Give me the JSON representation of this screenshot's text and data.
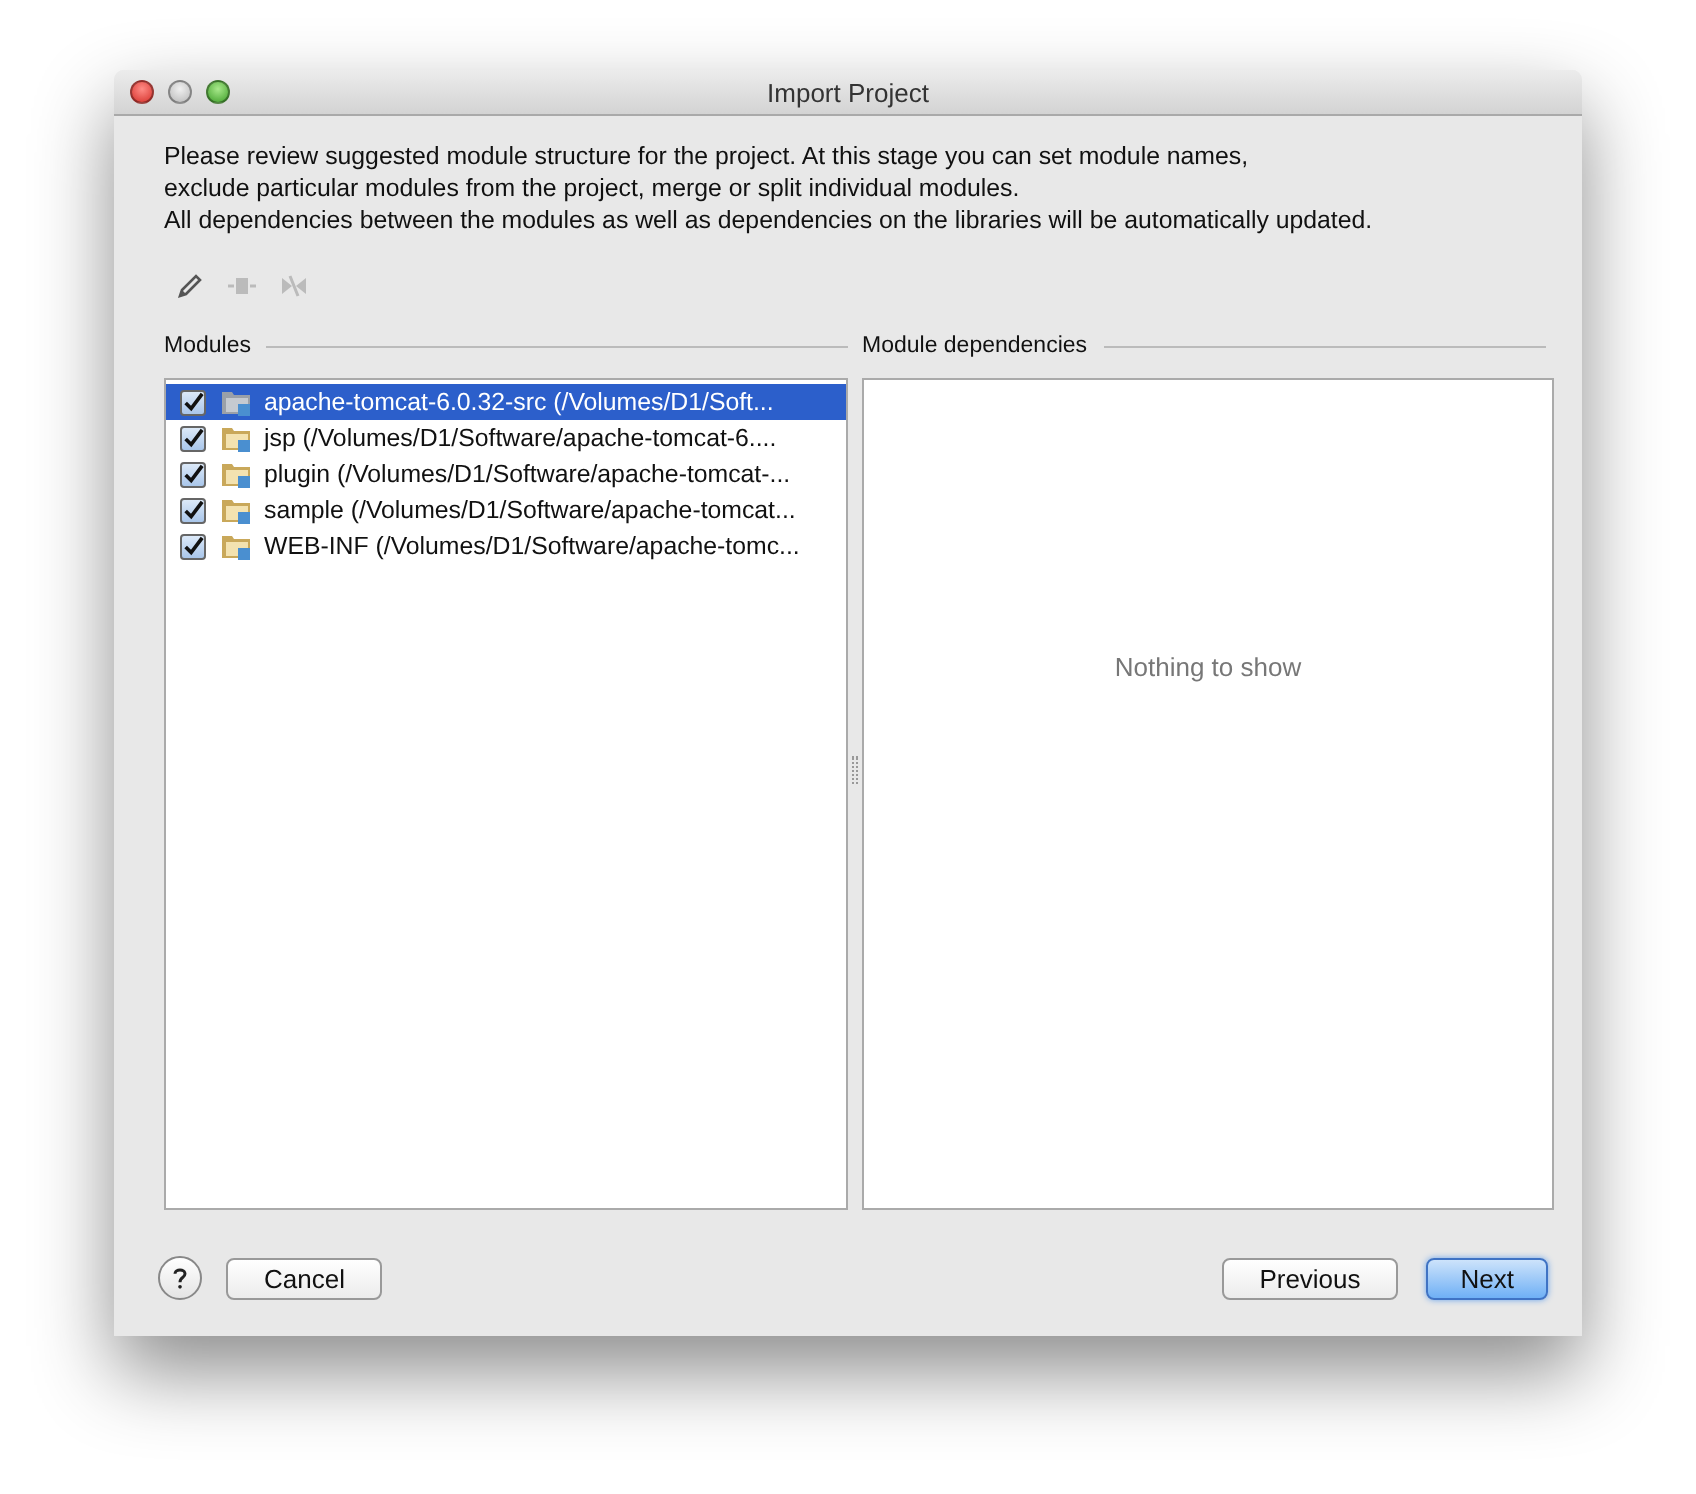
{
  "window": {
    "title": "Import Project"
  },
  "description": [
    "Please review suggested module structure for the project. At this stage you can set module names,",
    "exclude particular modules from the project, merge or split individual modules.",
    "All dependencies between the modules as well as dependencies on the libraries will be automatically updated."
  ],
  "toolbar": [
    {
      "kind": "edit",
      "disabled": false
    },
    {
      "kind": "merge",
      "disabled": true
    },
    {
      "kind": "split",
      "disabled": true
    }
  ],
  "modules": {
    "title": "Modules",
    "items": [
      {
        "label": "apache-tomcat-6.0.32-src (/Volumes/D1/Soft...",
        "checked": true,
        "selected": true
      },
      {
        "label": "jsp (/Volumes/D1/Software/apache-tomcat-6....",
        "checked": true,
        "selected": false
      },
      {
        "label": "plugin (/Volumes/D1/Software/apache-tomcat-...",
        "checked": true,
        "selected": false
      },
      {
        "label": "sample (/Volumes/D1/Software/apache-tomcat...",
        "checked": true,
        "selected": false
      },
      {
        "label": "WEB-INF (/Volumes/D1/Software/apache-tomc...",
        "checked": true,
        "selected": false
      }
    ]
  },
  "dependencies": {
    "title": "Module dependencies",
    "empty_text": "Nothing to show"
  },
  "buttons": [
    {
      "label": "Cancel",
      "kind": "normal"
    },
    {
      "label": "Previous",
      "kind": "normal"
    },
    {
      "label": "Next",
      "kind": "default"
    }
  ]
}
